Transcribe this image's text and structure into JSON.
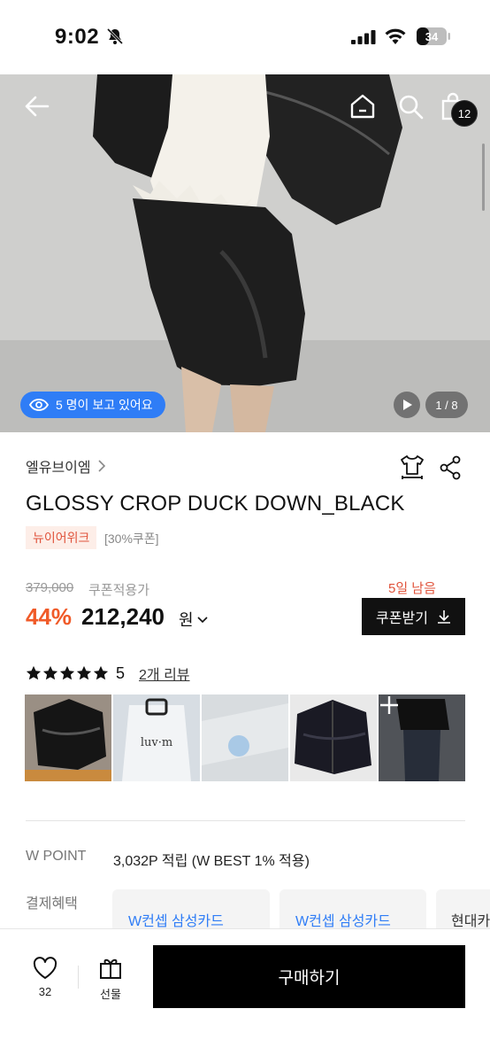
{
  "status_bar": {
    "time": "9:02",
    "battery": "34",
    "icons": [
      "bell-off-icon",
      "signal-icon",
      "wifi-icon",
      "battery-icon"
    ]
  },
  "top_nav": {
    "icons": [
      "back-arrow-icon",
      "home-icon",
      "search-icon",
      "shopping-bag-icon"
    ],
    "cart_count": "12"
  },
  "gallery": {
    "viewers_text": "5 명이 보고 있어요",
    "counter": "1 / 8",
    "icons": [
      "eye-icon",
      "play-icon"
    ]
  },
  "product": {
    "brand": "엘유브이엠",
    "title": "GLOSSY CROP DUCK DOWN_BLACK",
    "tags": {
      "new": "뉴이어위크",
      "coupon": "[30%쿠폰]"
    },
    "original_price": "379,000",
    "original_note": "쿠폰적용가",
    "days_left": "5일 남음",
    "discount": "44%",
    "price": "212,240",
    "currency": "원",
    "coupon_button": "쿠폰받기",
    "icons": [
      "chevron-right-icon",
      "fit-guide-icon",
      "share-icon",
      "chevron-down-icon",
      "download-icon"
    ]
  },
  "reviews": {
    "rating": 5,
    "score_text": "5",
    "link_text": "2개 리뷰",
    "thumbnail_count": 5
  },
  "benefits": {
    "wpoint_label": "W POINT",
    "wpoint_value": "3,032P 적립 (W BEST 1% 적용)",
    "payment_label": "결제혜택",
    "cards": [
      "W컨셉 삼성카드",
      "W컨셉 삼성카드",
      "현대카"
    ]
  },
  "bottom_bar": {
    "like_count": "32",
    "gift_label": "선물",
    "buy_label": "구매하기",
    "icons": [
      "heart-icon",
      "gift-icon"
    ]
  },
  "colors": {
    "accent_blue": "#2f7df6",
    "discount_orange": "#f05a28",
    "tag_red": "#e0533b",
    "black": "#111111"
  }
}
